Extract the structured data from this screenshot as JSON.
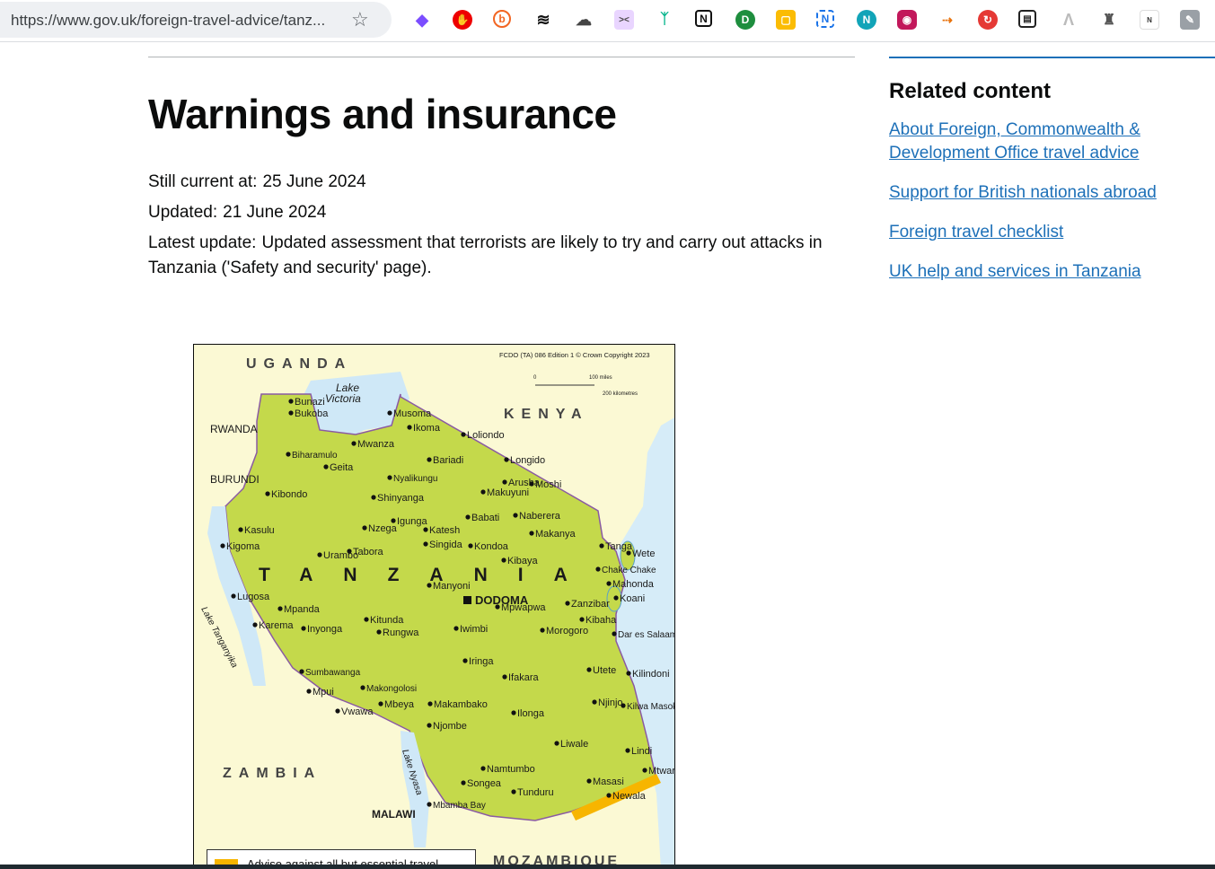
{
  "browser": {
    "url": "https://www.gov.uk/foreign-travel-advice/tanz...",
    "extensions": [
      "diamond-ext-icon",
      "shield-ext-icon",
      "b-ext-icon",
      "layers-ext-icon",
      "cloud-ext-icon",
      "face-ext-icon",
      "tf-ext-icon",
      "notion-ext-icon",
      "d-ext-icon",
      "note-ext-icon",
      "n-box-ext-icon",
      "n-circle-ext-icon",
      "camera-ext-icon",
      "arrow-ext-icon",
      "sync-ext-icon",
      "book-ext-icon",
      "a-ext-icon",
      "hat-ext-icon",
      "small-ext-icon",
      "puzzle-ext-icon"
    ]
  },
  "page": {
    "title": "Warnings and insurance",
    "still_current_label": "Still current at:",
    "still_current_value": "25 June 2024",
    "updated_label": "Updated:",
    "updated_value": "21 June 2024",
    "latest_update_label": "Latest update:",
    "latest_update_value": "Updated assessment that terrorists are likely to try and carry out attacks in Tanzania ('Safety and security' page)."
  },
  "related": {
    "title": "Related content",
    "links": [
      "About Foreign, Commonwealth & Development Office travel advice",
      "Support for British nationals abroad",
      "Foreign travel checklist",
      "UK help and services in Tanzania"
    ]
  },
  "map": {
    "copyright": "FCDO (TA) 086 Edition 1 © Crown Copyright 2023",
    "scale_miles": "100 miles",
    "scale_km": "200 kilometres",
    "scale_zero": "0",
    "countries": {
      "uganda": "UGANDA",
      "kenya": "KENYA",
      "rwanda": "RWANDA",
      "burundi": "BURUNDI",
      "tanzania": "TANZANIA",
      "zambia": "ZAMBIA",
      "malawi": "MALAWI",
      "mozambique": "MOZAMBIQUE"
    },
    "lakes": {
      "victoria_1": "Lake",
      "victoria_2": "Victoria",
      "tanganyika": "Lake Tanganyika",
      "nyasa": "Lake Nyasa"
    },
    "capital": "DODOMA",
    "cities": [
      "Bunazi",
      "Bukoba",
      "Musoma",
      "Ikoma",
      "Loliondo",
      "Mwanza",
      "Biharamulo",
      "Bariadi",
      "Longido",
      "Geita",
      "Nyalikungu",
      "Arusha",
      "Moshi",
      "Makuyuni",
      "Kibondo",
      "Shinyanga",
      "Igunga",
      "Babati",
      "Naberera",
      "Kasulu",
      "Nzega",
      "Katesh",
      "Makanya",
      "Kigoma",
      "Tabora",
      "Singida",
      "Kondoa",
      "Tanga",
      "Wete",
      "Urambo",
      "Kibaya",
      "Chake Chake",
      "Mahonda",
      "Manyoni",
      "Koani",
      "Zanzibar",
      "Lugosa",
      "Mpwapwa",
      "Mpanda",
      "Kitunda",
      "Kibaha",
      "Karema",
      "Inyonga",
      "Rungwa",
      "Iwimbi",
      "Morogoro",
      "Dar es Salaam",
      "Iringa",
      "Sumbawanga",
      "Utete",
      "Ifakara",
      "Kilindoni",
      "Makongolosi",
      "Mpui",
      "Njinjo",
      "Kilwa Masoko",
      "Mbeya",
      "Makambako",
      "Vwawa",
      "Ilonga",
      "Njombe",
      "Liwale",
      "Lindi",
      "Namtumbo",
      "Mtwara",
      "Songea",
      "Masasi",
      "Tunduru",
      "Newala",
      "Mbamba Bay"
    ],
    "legend": "Advise against all but essential travel"
  }
}
